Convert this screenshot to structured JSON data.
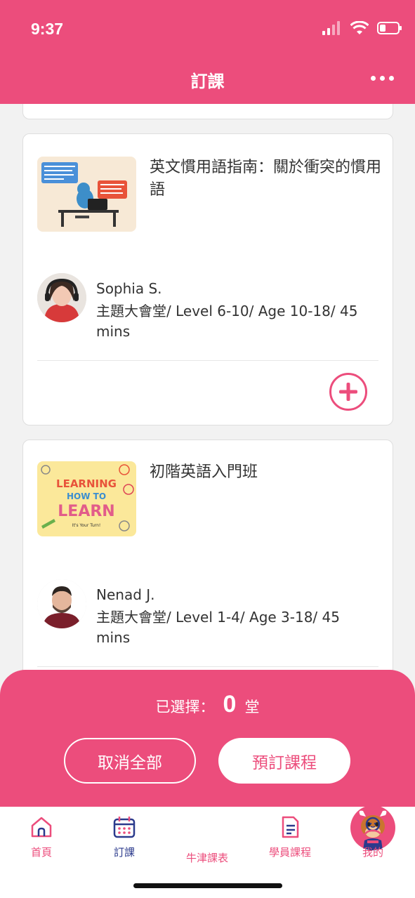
{
  "status_bar": {
    "time": "9:37"
  },
  "header": {
    "title": "訂課"
  },
  "courses": [
    {
      "title": "英文慣用語指南：關於衝突的慣用語",
      "thumbnail_icon": "video-call-illustration",
      "teacher": {
        "name": "Sophia S.",
        "info": "主題大會堂/ Level 6-10/ Age 10-18/ 45 mins"
      }
    },
    {
      "title": "初階英語入門班",
      "thumbnail_icon": "learning-how-to-learn-cover",
      "thumbnail_text": {
        "line1": "LEARNING",
        "line2": "HOW TO",
        "line3": "LEARN",
        "line4": "It's Your Turn!"
      },
      "teacher": {
        "name": "Nenad J.",
        "info": "主題大會堂/ Level 1-4/ Age 3-18/ 45 mins"
      }
    }
  ],
  "selection": {
    "prefix": "已選擇：",
    "count": "0",
    "suffix": "堂"
  },
  "actions": {
    "cancel_all": "取消全部",
    "book": "預訂課程"
  },
  "tabs": [
    {
      "label": "首頁",
      "icon": "home-icon"
    },
    {
      "label": "訂課",
      "icon": "calendar-icon",
      "active": true
    },
    {
      "label": "牛津課表",
      "icon": "mascot-icon"
    },
    {
      "label": "學員課程",
      "icon": "document-icon"
    },
    {
      "label": "我的",
      "icon": "user-icon"
    }
  ],
  "colors": {
    "brand": "#ec4d7c",
    "active_tab": "#2b3a8c",
    "background": "#f2f2f2"
  }
}
